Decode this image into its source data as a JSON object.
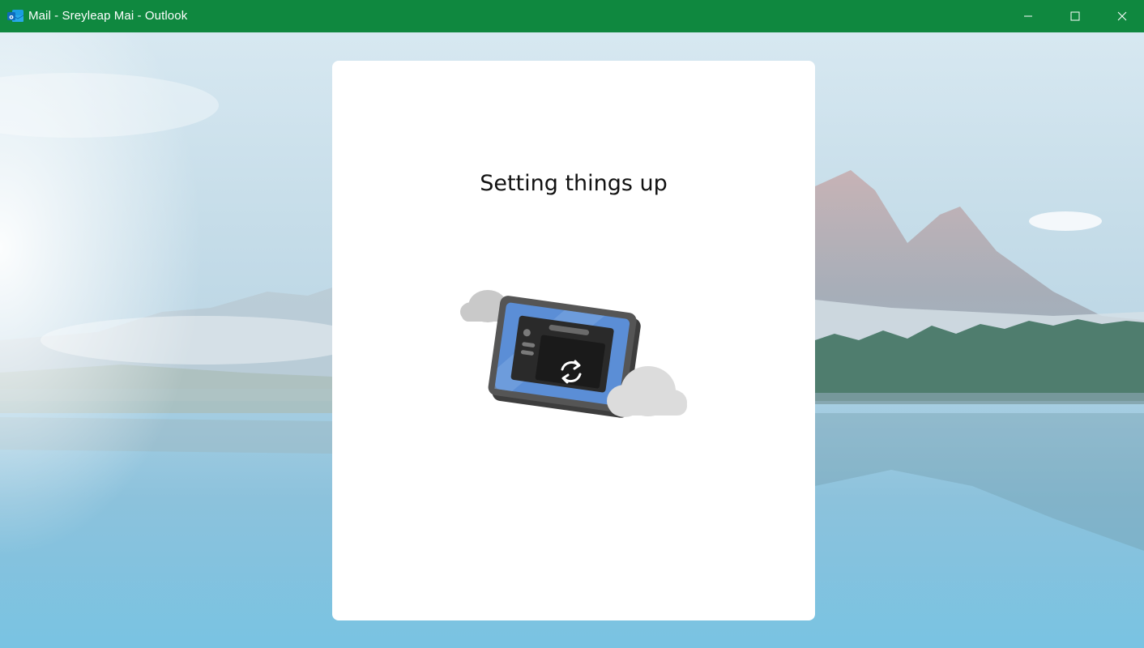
{
  "window": {
    "title": "Mail - Sreyleap Mai - Outlook",
    "titlebar_color": "#0f883f",
    "app_icon": "outlook-icon",
    "controls": {
      "minimize": "minimize-icon",
      "maximize": "maximize-icon",
      "close": "close-icon"
    }
  },
  "setup": {
    "title": "Setting things up",
    "illustration": "device-sync-illustration",
    "sync_icon": "sync-icon"
  },
  "background": {
    "description_icon": "mountain-lake-wallpaper"
  }
}
